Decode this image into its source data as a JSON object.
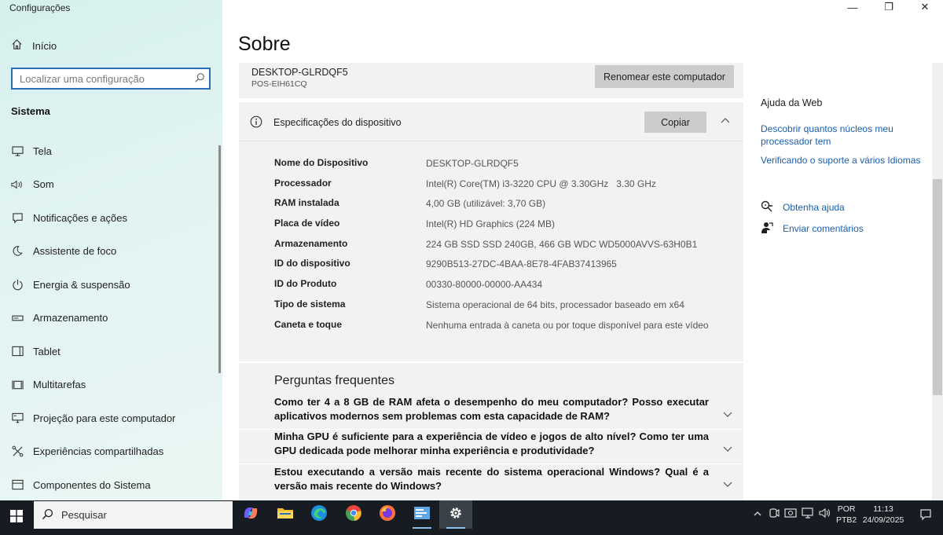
{
  "app": {
    "title": "Configurações"
  },
  "window": {
    "minimize": "—",
    "maximize": "❐",
    "close": "✕"
  },
  "sidebar": {
    "home_label": "Início",
    "search_placeholder": "Localizar uma configuração",
    "section_title": "Sistema",
    "items": [
      {
        "label": "Tela",
        "icon": "monitor-icon"
      },
      {
        "label": "Som",
        "icon": "speaker-icon"
      },
      {
        "label": "Notificações e ações",
        "icon": "notification-icon"
      },
      {
        "label": "Assistente de foco",
        "icon": "moon-icon"
      },
      {
        "label": "Energia & suspensão",
        "icon": "power-icon"
      },
      {
        "label": "Armazenamento",
        "icon": "storage-icon"
      },
      {
        "label": "Tablet",
        "icon": "tablet-icon"
      },
      {
        "label": "Multitarefas",
        "icon": "multitask-icon"
      },
      {
        "label": "Projeção para este computador",
        "icon": "projection-icon"
      },
      {
        "label": "Experiências compartilhadas",
        "icon": "shared-icon"
      },
      {
        "label": "Componentes do Sistema",
        "icon": "components-icon"
      }
    ]
  },
  "main": {
    "title": "Sobre",
    "pc": {
      "name": "DESKTOP-GLRDQF5",
      "subtitle": "POS-EIH61CQ",
      "rename_button": "Renomear este computador"
    },
    "specs": {
      "title": "Especificações do dispositivo",
      "copy_button": "Copiar",
      "rows": [
        {
          "label": "Nome do Dispositivo",
          "value": "DESKTOP-GLRDQF5"
        },
        {
          "label": "Processador",
          "value": "Intel(R) Core(TM) i3-3220 CPU @ 3.30GHz   3.30 GHz"
        },
        {
          "label": "RAM instalada",
          "value": "4,00 GB (utilizável: 3,70 GB)"
        },
        {
          "label": "Placa de vídeo",
          "value": "Intel(R) HD Graphics (224 MB)"
        },
        {
          "label": "Armazenamento",
          "value": "224 GB SSD SSD 240GB, 466 GB WDC WD5000AVVS-63H0B1"
        },
        {
          "label": "ID do dispositivo",
          "value": "9290B513-27DC-4BAA-8E78-4FAB37413965"
        },
        {
          "label": "ID do Produto",
          "value": "00330-80000-00000-AA434"
        },
        {
          "label": "Tipo de sistema",
          "value": "Sistema operacional de 64 bits, processador baseado em x64"
        },
        {
          "label": "Caneta e toque",
          "value": "Nenhuma entrada à caneta ou por toque disponível para este vídeo"
        }
      ]
    },
    "faq": {
      "title": "Perguntas frequentes",
      "items": [
        "Como ter 4 a 8 GB de RAM afeta o desempenho do meu computador? Posso executar aplicativos modernos sem problemas com esta capacidade de RAM?",
        "Minha GPU é suficiente para a experiência de vídeo e jogos de alto nível? Como ter uma GPU dedicada pode melhorar minha experiência e produtividade?",
        "Estou executando a versão mais recente do sistema operacional Windows? Qual é a versão mais recente do Windows?"
      ]
    }
  },
  "right": {
    "title": "Ajuda da Web",
    "links": [
      "Descobrir quantos núcleos meu processador tem",
      "Verificando o suporte a vários Idiomas"
    ],
    "get_help": "Obtenha ajuda",
    "feedback": "Enviar comentários"
  },
  "taskbar": {
    "search_label": "Pesquisar",
    "lang_1": "POR",
    "lang_2": "PTB2",
    "time": "11:13",
    "date": "24/09/2025"
  }
}
